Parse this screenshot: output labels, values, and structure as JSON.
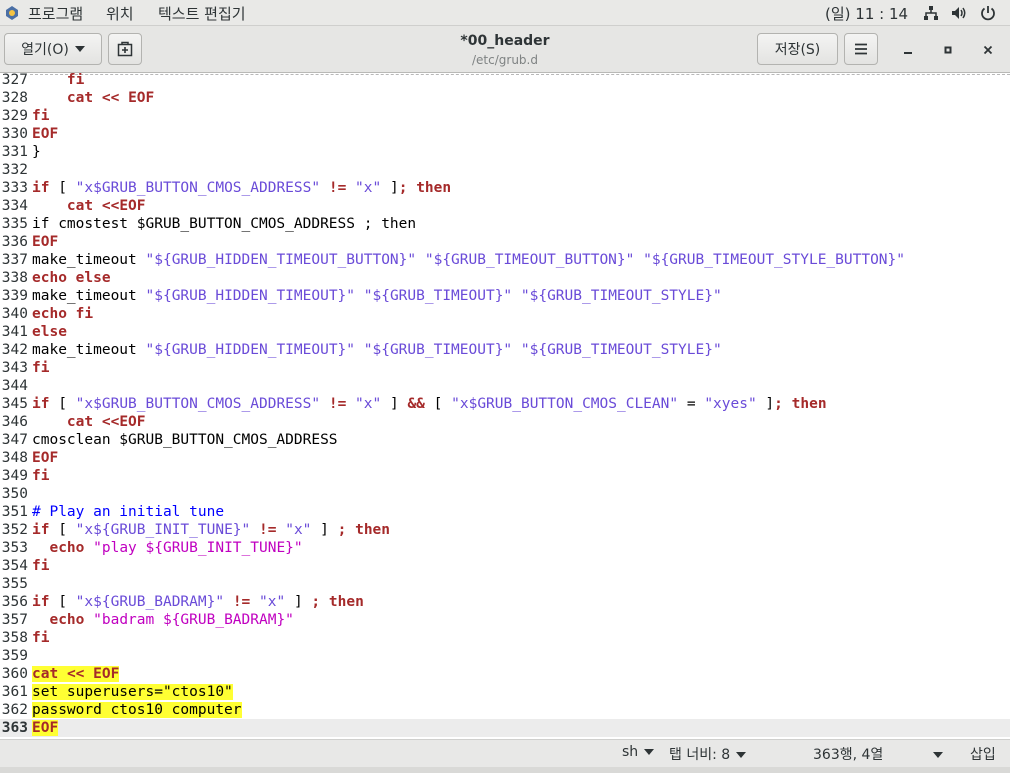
{
  "topbar": {
    "menu": [
      "프로그램",
      "위치",
      "텍스트 편집기"
    ],
    "clock": "(일) 11 : 14",
    "icons": [
      "network-icon",
      "volume-icon",
      "power-icon"
    ]
  },
  "header": {
    "open_label": "열기(O)",
    "title": "*00_header",
    "subtitle": "/etc/grub.d",
    "save_label": "저장(S)"
  },
  "colors": {
    "keyword": "#a52a2a",
    "string": "#6a4bd8",
    "comment": "#0000ff",
    "highlight": "#ffff33"
  },
  "editor": {
    "current_line": "363",
    "lines": [
      {
        "n": "327",
        "t": "    fi"
      },
      {
        "n": "328",
        "t": "    cat << EOF"
      },
      {
        "n": "329",
        "t": "fi"
      },
      {
        "n": "330",
        "t": "EOF"
      },
      {
        "n": "331",
        "t": "}"
      },
      {
        "n": "332",
        "t": ""
      },
      {
        "n": "333",
        "t": "if [ \"x$GRUB_BUTTON_CMOS_ADDRESS\" != \"x\" ]; then"
      },
      {
        "n": "334",
        "t": "    cat <<EOF"
      },
      {
        "n": "335",
        "t": "if cmostest $GRUB_BUTTON_CMOS_ADDRESS ; then"
      },
      {
        "n": "336",
        "t": "EOF"
      },
      {
        "n": "337",
        "t": "make_timeout \"${GRUB_HIDDEN_TIMEOUT_BUTTON}\" \"${GRUB_TIMEOUT_BUTTON}\" \"${GRUB_TIMEOUT_STYLE_BUTTON}\""
      },
      {
        "n": "338",
        "t": "echo else"
      },
      {
        "n": "339",
        "t": "make_timeout \"${GRUB_HIDDEN_TIMEOUT}\" \"${GRUB_TIMEOUT}\" \"${GRUB_TIMEOUT_STYLE}\""
      },
      {
        "n": "340",
        "t": "echo fi"
      },
      {
        "n": "341",
        "t": "else"
      },
      {
        "n": "342",
        "t": "make_timeout \"${GRUB_HIDDEN_TIMEOUT}\" \"${GRUB_TIMEOUT}\" \"${GRUB_TIMEOUT_STYLE}\""
      },
      {
        "n": "343",
        "t": "fi"
      },
      {
        "n": "344",
        "t": ""
      },
      {
        "n": "345",
        "t": "if [ \"x$GRUB_BUTTON_CMOS_ADDRESS\" != \"x\" ] && [ \"x$GRUB_BUTTON_CMOS_CLEAN\" = \"xyes\" ]; then"
      },
      {
        "n": "346",
        "t": "    cat <<EOF"
      },
      {
        "n": "347",
        "t": "cmosclean $GRUB_BUTTON_CMOS_ADDRESS"
      },
      {
        "n": "348",
        "t": "EOF"
      },
      {
        "n": "349",
        "t": "fi"
      },
      {
        "n": "350",
        "t": ""
      },
      {
        "n": "351",
        "t": "# Play an initial tune"
      },
      {
        "n": "352",
        "t": "if [ \"x${GRUB_INIT_TUNE}\" != \"x\" ] ; then"
      },
      {
        "n": "353",
        "t": "  echo \"play ${GRUB_INIT_TUNE}\""
      },
      {
        "n": "354",
        "t": "fi"
      },
      {
        "n": "355",
        "t": ""
      },
      {
        "n": "356",
        "t": "if [ \"x${GRUB_BADRAM}\" != \"x\" ] ; then"
      },
      {
        "n": "357",
        "t": "  echo \"badram ${GRUB_BADRAM}\""
      },
      {
        "n": "358",
        "t": "fi"
      },
      {
        "n": "359",
        "t": ""
      },
      {
        "n": "360",
        "t": "cat << EOF"
      },
      {
        "n": "361",
        "t": "set superusers=\"ctos10\""
      },
      {
        "n": "362",
        "t": "password ctos10 computer"
      },
      {
        "n": "363",
        "t": "EOF"
      }
    ]
  },
  "status": {
    "language": "sh",
    "tab_width": "탭 너비: 8",
    "position": "363행, 4열",
    "mode": "삽입"
  }
}
